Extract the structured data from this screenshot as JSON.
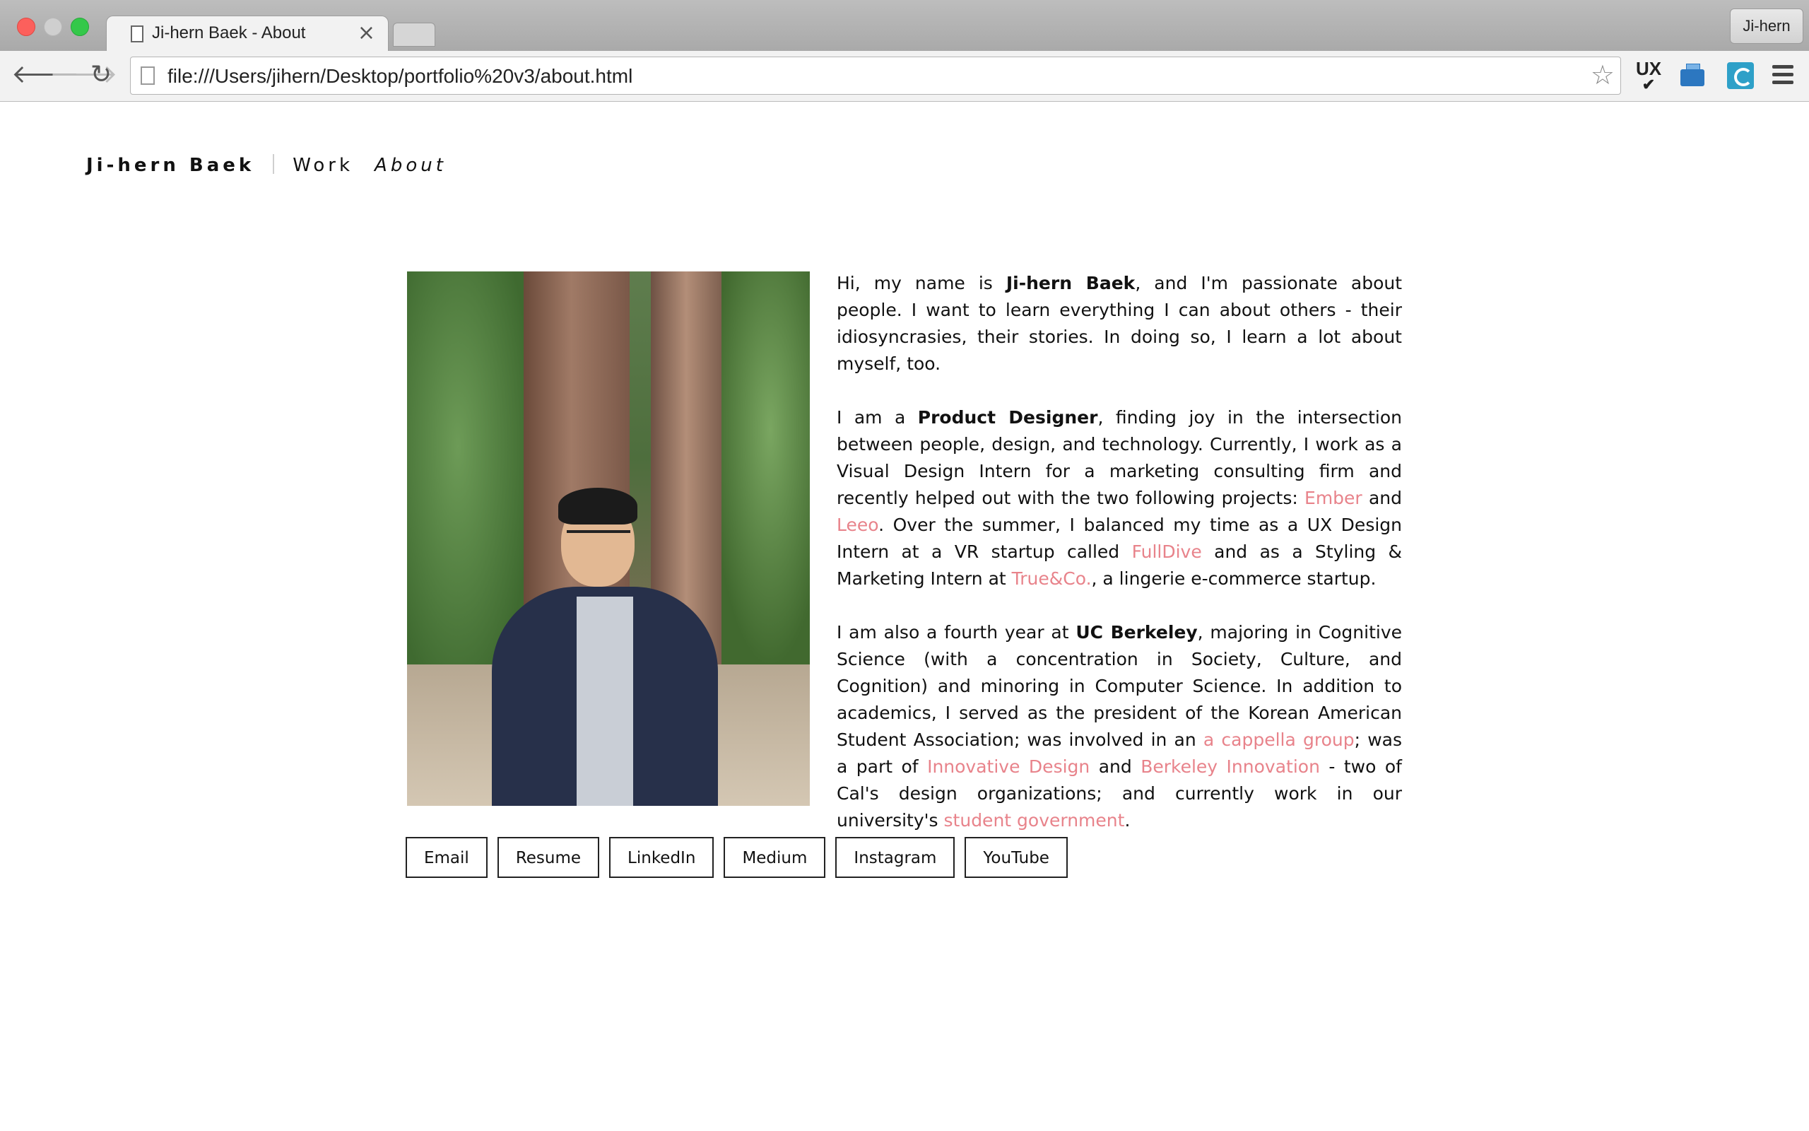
{
  "browser": {
    "tab_title": "Ji-hern Baek - About",
    "tab_close": "×",
    "profile_name": "Ji-hern",
    "url": "file:///Users/jihern/Desktop/portfolio%20v3/about.html",
    "back_icon": "🡐",
    "forward_icon": "🡒",
    "reload_icon": "↻",
    "star_icon": "☆",
    "ux_ext_label": "UX",
    "ux_ext_check": "✔"
  },
  "nav": {
    "name": "Ji-hern Baek",
    "work": "Work",
    "about": "About"
  },
  "bio": {
    "p1": {
      "t1": "Hi, my name is ",
      "b1": "Ji-hern Baek",
      "t2": ", and I'm passionate about people. I want to learn everything I can about others - their idiosyncrasies, their stories. In doing so, I learn a lot about myself, too."
    },
    "p2": {
      "t1": "I am a ",
      "b1": "Product Designer",
      "t2": ", finding joy in the intersection between people, design, and technology. Currently, I work as a Visual Design Intern for a marketing consulting firm and recently helped out with the two following projects: ",
      "l1": "Ember",
      "t3": " and ",
      "l2": "Leeo",
      "t4": ". Over the summer, I balanced my time as a UX Design Intern at a VR startup called ",
      "l3": "FullDive",
      "t5": " and as a Styling & Marketing Intern at ",
      "l4": "True&Co.",
      "t6": ", a lingerie e-commerce startup."
    },
    "p3": {
      "t1": "I am also a fourth year at ",
      "b1": "UC Berkeley",
      "t2": ", majoring in Cognitive Science (with a concentration in Society, Culture, and Cognition) and minoring in Computer Science. In addition to academics, I served as the president of the Korean American Student Association; was involved in an ",
      "l1": "a cappella group",
      "t3": "; was a part of ",
      "l2": "Innovative Design",
      "t4": " and ",
      "l3": "Berkeley Innovation",
      "t5": " - two of Cal's design organizations; and currently work in our university's ",
      "l4": "student government",
      "t6": "."
    }
  },
  "buttons": [
    "Email",
    "Resume",
    "LinkedIn",
    "Medium",
    "Instagram",
    "YouTube"
  ],
  "colors": {
    "link": "#e8838b",
    "text": "#111111"
  }
}
